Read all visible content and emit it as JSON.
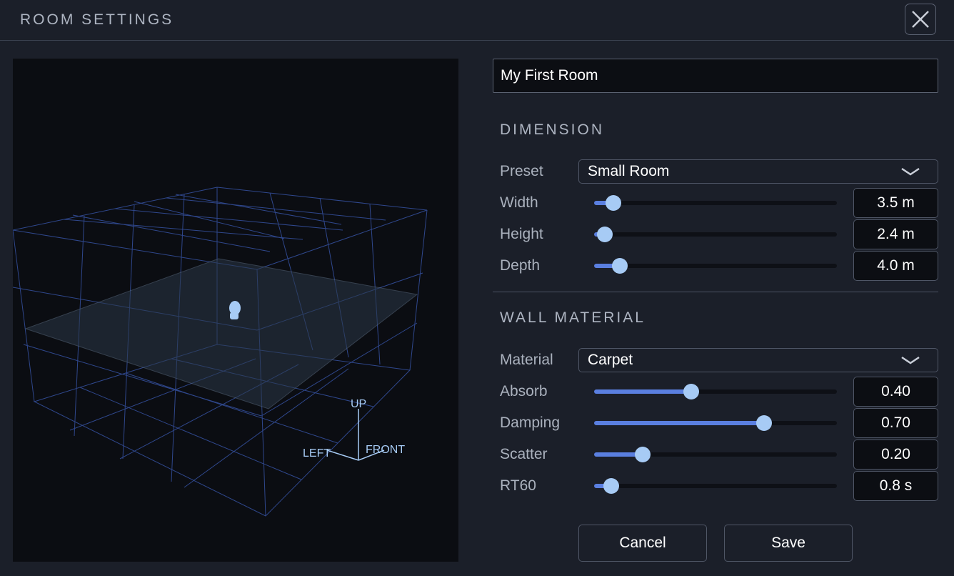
{
  "window": {
    "title": "ROOM SETTINGS",
    "close_icon": "close-icon"
  },
  "room_name": {
    "value": "My First Room"
  },
  "viewport": {
    "axis_up": "UP",
    "axis_left": "LEFT",
    "axis_front": "FRONT",
    "listener_icon": "head-icon"
  },
  "dimension": {
    "title": "DIMENSION",
    "preset": {
      "label": "Preset",
      "value": "Small Room"
    },
    "rows": [
      {
        "label": "Width",
        "value": "3.5 m",
        "level": 0.08
      },
      {
        "label": "Height",
        "value": "2.4 m",
        "level": 0.045
      },
      {
        "label": "Depth",
        "value": "4.0 m",
        "level": 0.105
      }
    ]
  },
  "wall_material": {
    "title": "WALL MATERIAL",
    "material": {
      "label": "Material",
      "value": "Carpet"
    },
    "rows": [
      {
        "label": "Absorb",
        "value": "0.40",
        "level": 0.4
      },
      {
        "label": "Damping",
        "value": "0.70",
        "level": 0.7
      },
      {
        "label": "Scatter",
        "value": "0.20",
        "level": 0.2
      },
      {
        "label": "RT60",
        "value": "0.8 s",
        "level": 0.07
      }
    ]
  },
  "buttons": {
    "cancel": "Cancel",
    "save": "Save"
  },
  "colors": {
    "accent": "#5a7fe0",
    "thumb": "#a7cbf5",
    "background": "#1b1f29",
    "viewport": "#0b0d12",
    "grid": "#3b5bb5",
    "floor": "#2a3848"
  }
}
